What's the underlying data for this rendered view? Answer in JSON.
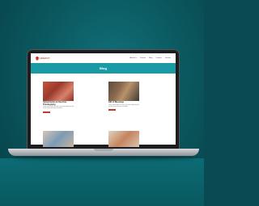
{
  "site": {
    "logo_text": "LEGACY",
    "nav": [
      "About Us",
      "Events",
      "Blog",
      "Contact",
      "Donate"
    ],
    "hero_title": "Blog"
  },
  "posts": [
    {
      "title": "Humanitarian & Churches Thanksgiving",
      "excerpt": "Lorem ipsum dolor sit amet consectetur adipiscing elit sed do eiusmod tempor incididunt"
    },
    {
      "title": "Gift of Blessings",
      "excerpt": "Lorem ipsum dolor sit amet consectetur adipiscing elit sed do eiusmod tempor incididunt"
    }
  ],
  "colors": {
    "accent": "#1a9aa5",
    "brand": "#c0392b",
    "background": "#0b5960"
  }
}
